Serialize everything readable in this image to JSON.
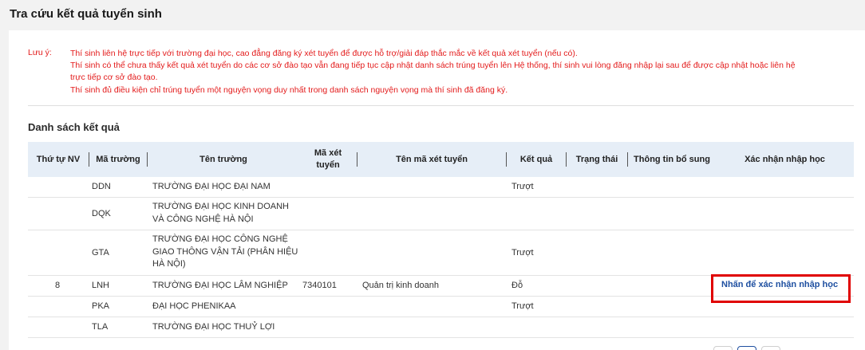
{
  "page": {
    "title": "Tra cứu kết quả tuyển sinh"
  },
  "notes": {
    "label": "Lưu ý:",
    "lines": [
      "Thí sinh liên hệ trực tiếp với trường đại học, cao đẳng đăng ký xét tuyển để được hỗ trợ/giải đáp thắc mắc về kết quả xét tuyển (nếu có).",
      "Thí sinh có thể chưa thấy kết quả xét tuyển do các cơ sở đào tạo vẫn đang tiếp tục cập nhật danh sách trúng tuyển lên Hệ thống, thí sinh vui lòng đăng nhập lại sau để được cập nhật hoặc liên hệ",
      "trực tiếp cơ sở đào tạo.",
      "Thí sinh đủ điều kiện chỉ trúng tuyển một nguyện vọng duy nhất trong danh sách nguyện vọng mà thí sinh đã đăng ký."
    ],
    "color": "#e31b1b"
  },
  "results": {
    "title": "Danh sách kết quả",
    "columns": {
      "order": "Thứ tự NV",
      "school_code": "Mã trường",
      "school_name": "Tên trường",
      "admission_code_line1": "Mã xét",
      "admission_code_line2": "tuyển",
      "admission_name": "Tên mã xét tuyển",
      "result": "Kết quả",
      "status": "Trạng thái",
      "extra_info": "Thông tin bổ sung",
      "confirm": "Xác nhận nhập học"
    },
    "rows": [
      {
        "order": "",
        "code": "DDN",
        "name_lines": [
          "TRƯỜNG ĐẠI HỌC ĐẠI NAM"
        ],
        "admission_code": "",
        "admission_name": "",
        "result": "Trượt",
        "status": "",
        "extra": ""
      },
      {
        "order": "",
        "code": "DQK",
        "name_lines": [
          "TRƯỜNG ĐẠI HỌC KINH DOANH",
          "VÀ CÔNG NGHỆ HÀ NỘI"
        ],
        "admission_code": "",
        "admission_name": "",
        "result": "",
        "status": "",
        "extra": ""
      },
      {
        "order": "",
        "code": "GTA",
        "name_lines": [
          "TRƯỜNG ĐẠI HỌC CÔNG NGHỆ",
          "GIAO THÔNG VẬN TẢI (PHÂN HIỆU",
          "HÀ NỘI)"
        ],
        "admission_code": "",
        "admission_name": "",
        "result": "Trượt",
        "status": "",
        "extra": ""
      },
      {
        "order": "8",
        "code": "LNH",
        "name_lines": [
          "TRƯỜNG ĐẠI HỌC LÂM NGHIỆP"
        ],
        "admission_code": "7340101",
        "admission_name": "Quản trị kinh doanh",
        "result": "Đỗ",
        "status": "",
        "extra": ""
      },
      {
        "order": "",
        "code": "PKA",
        "name_lines": [
          "ĐẠI HỌC PHENIKAA"
        ],
        "admission_code": "",
        "admission_name": "",
        "result": "Trượt",
        "status": "",
        "extra": ""
      },
      {
        "order": "",
        "code": "TLA",
        "name_lines": [
          "TRƯỜNG ĐẠI HỌC THUỶ LỢI"
        ],
        "admission_code": "",
        "admission_name": "",
        "result": "",
        "status": "",
        "extra": ""
      }
    ],
    "confirm_link_label": "Nhấn để xác nhận nhập học",
    "link_color": "#1e4fa0",
    "highlight_color": "#e00000"
  },
  "pagination": {
    "controls": 3
  }
}
